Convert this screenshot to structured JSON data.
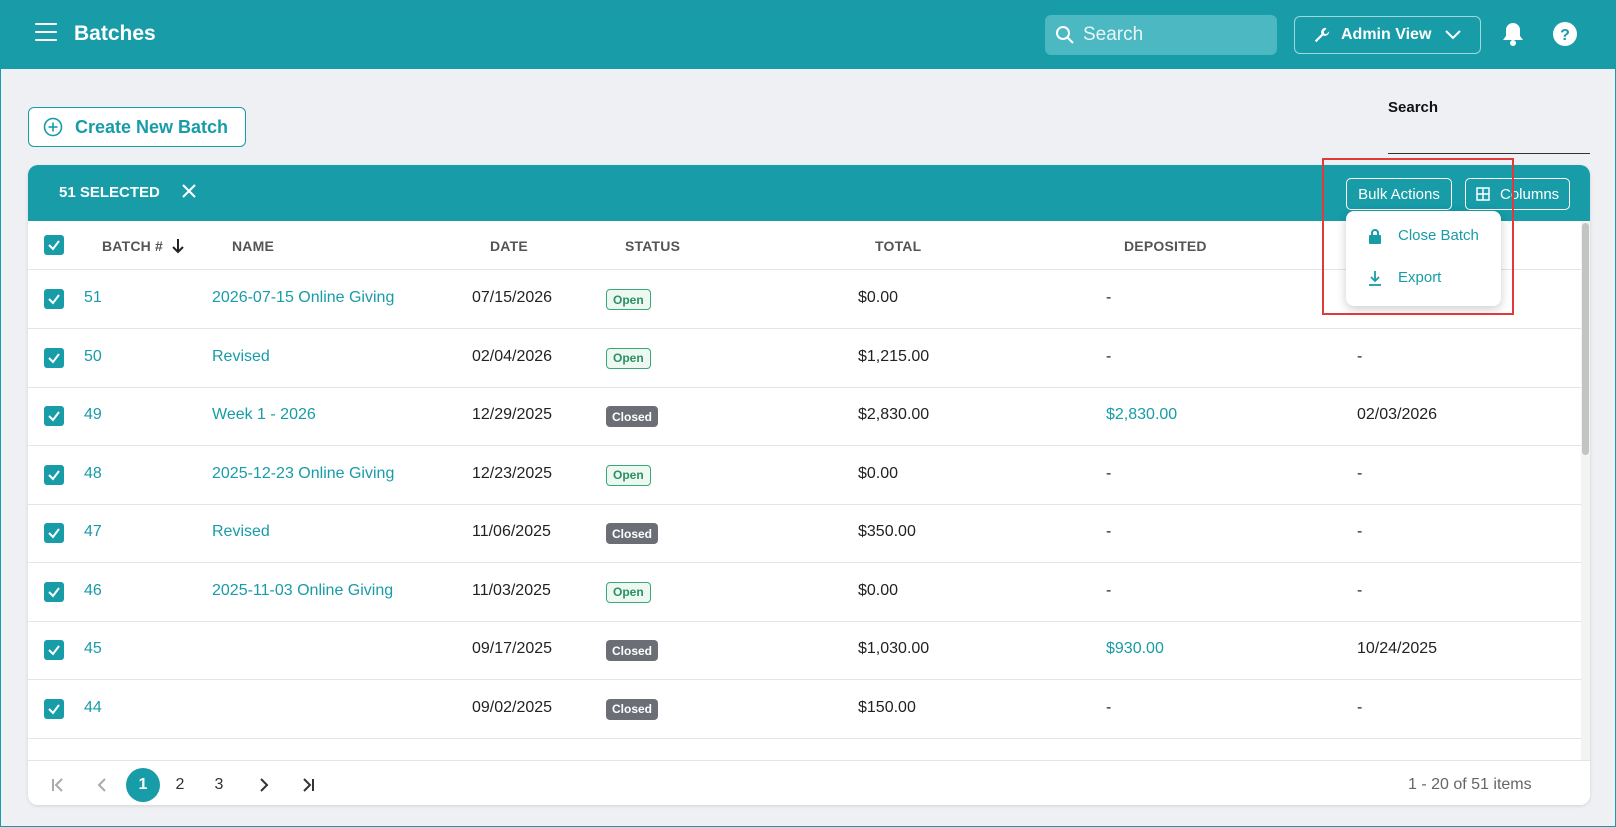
{
  "header": {
    "title": "Batches",
    "search_placeholder": "Search",
    "admin_label": "Admin View",
    "brand_color": "#179ca8"
  },
  "toolbar": {
    "create_label": "Create New Batch",
    "search_label": "Search"
  },
  "selection": {
    "count_label": "51 SELECTED",
    "bulk_label": "Bulk Actions",
    "columns_label": "Columns"
  },
  "bulk_menu": {
    "items": [
      {
        "label": "Close Batch",
        "icon": "lock-icon"
      },
      {
        "label": "Export",
        "icon": "download-icon"
      }
    ]
  },
  "table": {
    "columns": [
      "BATCH #",
      "NAME",
      "DATE",
      "STATUS",
      "TOTAL",
      "DEPOSITED"
    ],
    "rows": [
      {
        "batch": "51",
        "name": "2026-07-15 Online Giving",
        "date": "07/15/2026",
        "status": "Open",
        "total": "$0.00",
        "deposited": "-",
        "deposit_date": ""
      },
      {
        "batch": "50",
        "name": "Revised",
        "date": "02/04/2026",
        "status": "Open",
        "total": "$1,215.00",
        "deposited": "-",
        "deposit_date": "-"
      },
      {
        "batch": "49",
        "name": "Week 1 - 2026",
        "date": "12/29/2025",
        "status": "Closed",
        "total": "$2,830.00",
        "deposited": "$2,830.00",
        "deposit_date": "02/03/2026"
      },
      {
        "batch": "48",
        "name": "2025-12-23 Online Giving",
        "date": "12/23/2025",
        "status": "Open",
        "total": "$0.00",
        "deposited": "-",
        "deposit_date": "-"
      },
      {
        "batch": "47",
        "name": "Revised",
        "date": "11/06/2025",
        "status": "Closed",
        "total": "$350.00",
        "deposited": "-",
        "deposit_date": "-"
      },
      {
        "batch": "46",
        "name": "2025-11-03 Online Giving",
        "date": "11/03/2025",
        "status": "Open",
        "total": "$0.00",
        "deposited": "-",
        "deposit_date": "-"
      },
      {
        "batch": "45",
        "name": "",
        "date": "09/17/2025",
        "status": "Closed",
        "total": "$1,030.00",
        "deposited": "$930.00",
        "deposit_date": "10/24/2025"
      },
      {
        "batch": "44",
        "name": "",
        "date": "09/02/2025",
        "status": "Closed",
        "total": "$150.00",
        "deposited": "-",
        "deposit_date": "-"
      }
    ]
  },
  "pagination": {
    "pages": [
      "1",
      "2",
      "3"
    ],
    "current": "1",
    "info": "1 - 20 of 51 items"
  }
}
